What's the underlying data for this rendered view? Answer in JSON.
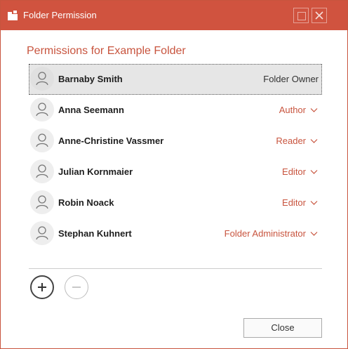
{
  "window": {
    "title": "Folder Permission",
    "accent_color": "#d0533f",
    "title_icon": "folder-share-icon"
  },
  "heading": "Permissions for Example Folder",
  "users": [
    {
      "name": "Barnaby Smith",
      "role": "Folder Owner",
      "selected": true,
      "editable": false
    },
    {
      "name": "Anna Seemann",
      "role": "Author",
      "selected": false,
      "editable": true
    },
    {
      "name": "Anne-Christine Vassmer",
      "role": "Reader",
      "selected": false,
      "editable": true
    },
    {
      "name": "Julian Kornmaier",
      "role": "Editor",
      "selected": false,
      "editable": true
    },
    {
      "name": "Robin Noack",
      "role": "Editor",
      "selected": false,
      "editable": true
    },
    {
      "name": "Stephan Kuhnert",
      "role": "Folder Administrator",
      "selected": false,
      "editable": true
    }
  ],
  "buttons": {
    "add_icon": "plus-icon",
    "remove_icon": "minus-icon",
    "close_label": "Close"
  }
}
